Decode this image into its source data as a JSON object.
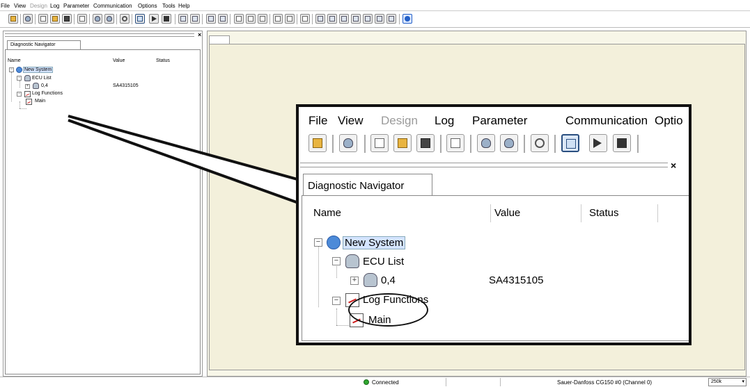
{
  "menubar": {
    "items": [
      "File",
      "View",
      "Design",
      "Log",
      "Parameter",
      "Communication",
      "Options",
      "Tools",
      "Help"
    ],
    "disabled": [
      "Design"
    ]
  },
  "toolbar": {
    "buttons": [
      "open-project-icon",
      "connect-icon",
      "new-document-icon",
      "open-folder-icon",
      "save-icon",
      "edit-icon",
      "download-icon",
      "upload-icon",
      "inspect-icon",
      "panel-view-icon",
      "play-icon",
      "stop-icon",
      "help-icon"
    ]
  },
  "navigator": {
    "tab_label": "Diagnostic Navigator",
    "close_glyph": "×",
    "columns": {
      "name": "Name",
      "value": "Value",
      "status": "Status"
    },
    "tree": {
      "root": {
        "label": "New System"
      },
      "ecu_list": {
        "label": "ECU List"
      },
      "ecu": {
        "label": "0,4",
        "value": "SA4315105"
      },
      "log_functions": {
        "label": "Log Functions"
      },
      "main": {
        "label": "Main"
      }
    }
  },
  "zoom": {
    "menu_items": [
      "File",
      "View",
      "Design",
      "Log",
      "Parameter",
      "Communication",
      "Optio"
    ]
  },
  "status": {
    "connection": "Connected",
    "device": "Sauer-Danfoss CG150 #0 (Channel 0)",
    "baud": "250k",
    "baud_arrow": "▾"
  }
}
